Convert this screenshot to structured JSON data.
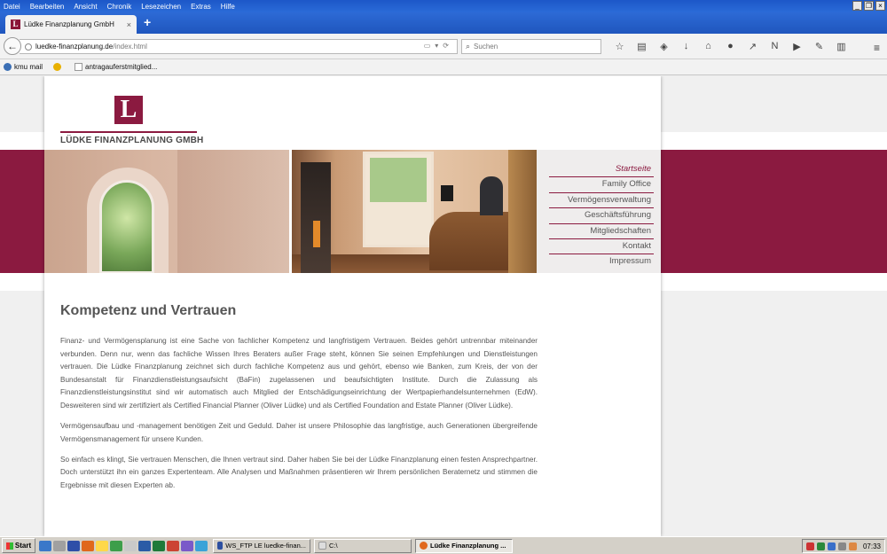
{
  "menubar": {
    "items": [
      "Datei",
      "Bearbeiten",
      "Ansicht",
      "Chronik",
      "Lesezeichen",
      "Extras",
      "Hilfe"
    ]
  },
  "tab": {
    "title": "Lüdke Finanzplanung GmbH",
    "close": "×",
    "new_tab": "+"
  },
  "navbar": {
    "url_host": "luedke-finanzplanung.de",
    "url_path": "/index.html",
    "search_placeholder": "Suchen"
  },
  "bookmarks": {
    "items": [
      "kmu mail",
      "antragauferstmitglied..."
    ]
  },
  "site": {
    "brand_color": "#8b1a40",
    "logo_letter": "L",
    "logo_text": "LÜDKE FINANZPLANUNG GMBH",
    "nav": [
      "Startseite",
      "Family Office",
      "Vermögensverwaltung",
      "Geschäftsführung",
      "Mitgliedschaften",
      "Kontakt",
      "Impressum"
    ],
    "heading": "Kompetenz und Vertrauen",
    "paragraphs": [
      "Finanz- und Vermögensplanung ist eine Sache von fachlicher Kompetenz und langfristigem Vertrauen. Beides gehört untrennbar miteinander verbunden. Denn nur, wenn das fachliche Wissen Ihres Beraters außer Frage steht, können Sie seinen Empfehlungen und Dienstleistungen vertrauen. Die Lüdke Finanzplanung zeichnet sich durch fachliche Kompetenz aus und gehört, ebenso wie Banken, zum Kreis, der von der Bundesanstalt für Finanzdienstleistungsaufsicht (BaFin) zugelassenen und beaufsichtigten Institute. Durch die Zulassung als Finanzdienstleistungsinstitut sind wir automatisch auch Mitglied der Entschädigungseinrichtung der Wertpapierhandelsunternehmen (EdW). Desweiteren sind wir zertifiziert als Certified Financial Planner (Oliver Lüdke) und als Certified Foundation and Estate Planner (Oliver Lüdke).",
      "Vermögensaufbau und -management benötigen Zeit und Geduld. Daher ist unsere Philosophie das langfristige, auch Generationen übergreifende Vermögensmanagement für unsere Kunden.",
      "So einfach es klingt, Sie vertrauen Menschen, die Ihnen vertraut sind. Daher haben Sie bei der Lüdke Finanzplanung einen festen Ansprechpartner. Doch unterstützt ihn ein ganzes Expertenteam. Alle Analysen und Maßnahmen präsentieren wir Ihrem persönlichen Beraternetz und stimmen die Ergebnisse mit diesen Experten ab."
    ]
  },
  "taskbar": {
    "start": "Start",
    "tasks": [
      "WS_FTP LE luedke-finan...",
      "C:\\",
      "Lüdke Finanzplanung ..."
    ],
    "clock": "07:33"
  }
}
